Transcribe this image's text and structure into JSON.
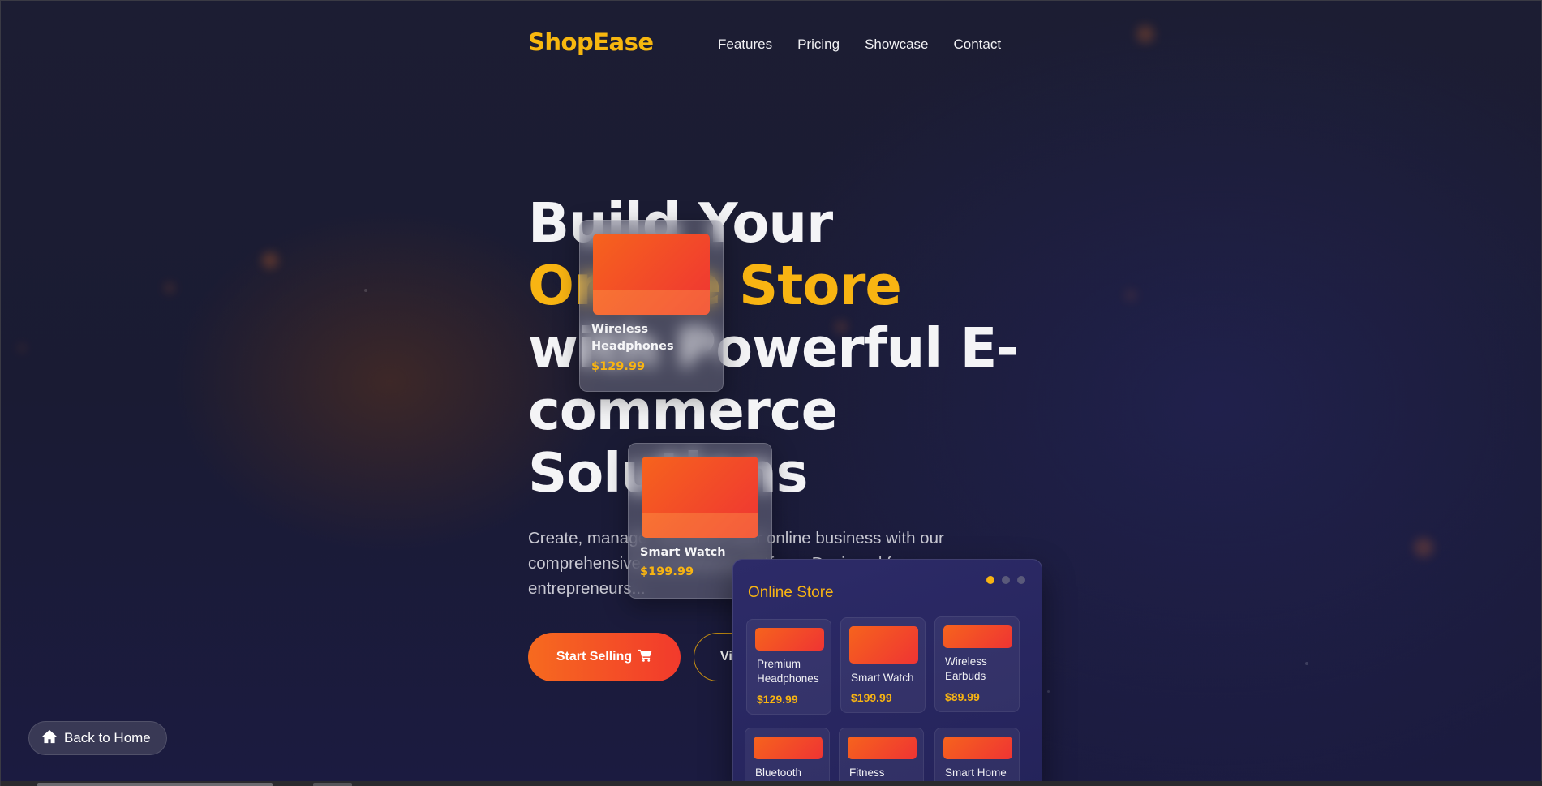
{
  "brand": {
    "logo": "ShopEase",
    "accent_color": "#f8b412",
    "gradient_start": "#f6631d",
    "gradient_end": "#ef3433"
  },
  "nav": {
    "items": [
      {
        "label": "Features"
      },
      {
        "label": "Pricing"
      },
      {
        "label": "Showcase"
      },
      {
        "label": "Contact"
      }
    ]
  },
  "hero": {
    "title_part1": "Build Your ",
    "title_accent": "Online Store",
    "title_part2": " with Powerful E-commerce Solutions",
    "description": "Create, manage, and grow your online business with our comprehensive e-commerce platform. Designed for entrepreneurs...",
    "primary_button": "Start Selling",
    "primary_icon": "shopping-cart-icon",
    "secondary_button": "View Demo"
  },
  "floating_cards": [
    {
      "name": "Wireless Headphones",
      "price": "$129.99"
    },
    {
      "name": "Smart Watch",
      "price": "$199.99"
    }
  ],
  "store_mockup": {
    "title": "Online Store",
    "products": [
      {
        "name": "Premium Headphones",
        "price": "$129.99"
      },
      {
        "name": "Smart Watch",
        "price": "$199.99"
      },
      {
        "name": "Wireless Earbuds",
        "price": "$89.99"
      },
      {
        "name": "Bluetooth Speaker",
        "price": ""
      },
      {
        "name": "Fitness",
        "price": ""
      },
      {
        "name": "Smart Home",
        "price": ""
      }
    ]
  },
  "back_home": {
    "label": "Back to Home",
    "icon": "home-icon"
  }
}
